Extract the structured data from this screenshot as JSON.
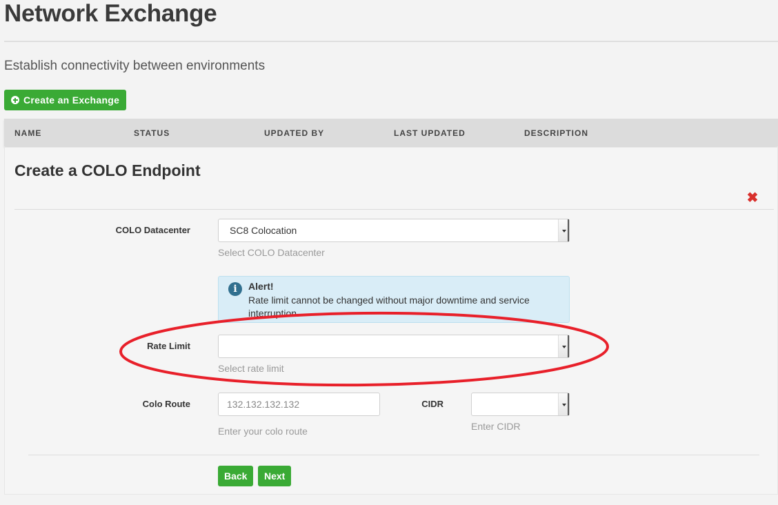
{
  "header": {
    "title": "Network Exchange",
    "subtitle": "Establish connectivity between environments",
    "create_button": "Create an Exchange"
  },
  "table": {
    "columns": [
      "NAME",
      "STATUS",
      "UPDATED BY",
      "LAST UPDATED",
      "DESCRIPTION"
    ]
  },
  "panel": {
    "title": "Create a COLO Endpoint",
    "datacenter": {
      "label": "COLO Datacenter",
      "value": "SC8 Colocation",
      "help": "Select COLO Datacenter"
    },
    "alert": {
      "title": "Alert!",
      "text": "Rate limit cannot be changed without major downtime and service interruption."
    },
    "rate_limit": {
      "label": "Rate Limit",
      "value": "",
      "help": "Select rate limit"
    },
    "colo_route": {
      "label": "Colo Route",
      "placeholder": "132.132.132.132",
      "help": "Enter your colo route"
    },
    "cidr": {
      "label": "CIDR",
      "value": "",
      "help": "Enter CIDR"
    },
    "back_button": "Back",
    "next_button": "Next"
  },
  "colors": {
    "accent_green": "#3aaa35",
    "close_red": "#d9302c",
    "annotation_red": "#e8202a",
    "alert_bg": "#d9edf7"
  },
  "icons": [
    "plus-circle-icon",
    "close-icon",
    "info-icon",
    "chevron-down-icon"
  ]
}
